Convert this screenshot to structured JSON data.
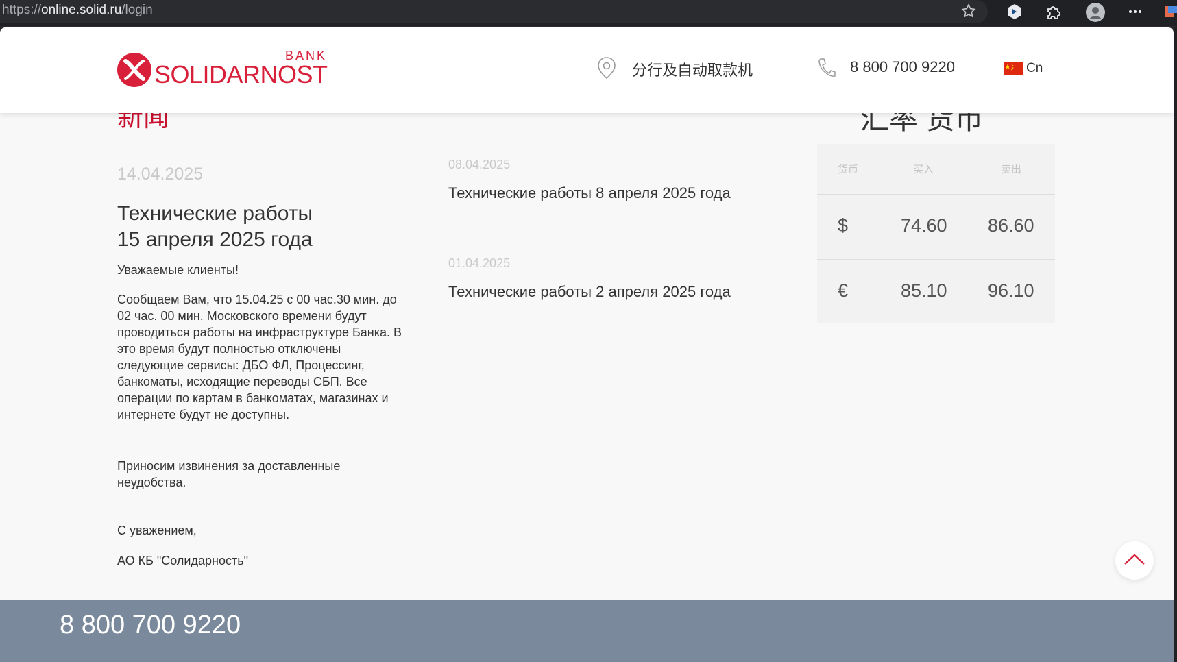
{
  "browser": {
    "url_scheme": "https://",
    "url_host": "online.solid.ru",
    "url_path": "/login"
  },
  "header": {
    "logo_bank": "BANK",
    "logo_name": "SOLIDARNOST",
    "branches_label": "分行及自动取款机",
    "phone": "8 800 700 9220",
    "language": "Cn"
  },
  "news": {
    "heading": "新闻",
    "main": {
      "date": "14.04.2025",
      "title_line1": "Технические работы",
      "title_line2": "15 апреля 2025 года",
      "greeting": "Уважаемые клиенты!",
      "paragraph": "Сообщаем Вам, что 15.04.25 с 00 час.30 мин. до 02 час. 00 мин. Московского времени будут проводиться работы на инфраструктуре Банка. В это время будут полностью отключены следующие сервисы: ДБО ФЛ, Процессинг, банкоматы, исходящие переводы СБП. Все операции по картам в банкоматах, магазинах и интернете будут не доступны.",
      "apology": "Приносим извинения за доставленные неудобства.",
      "regards": "С уважением,",
      "signature": "АО КБ \"Солидарность\""
    },
    "items": [
      {
        "date": "08.04.2025",
        "title": "Технические работы 8 апреля 2025 года"
      },
      {
        "date": "01.04.2025",
        "title": "Технические работы 2 апреля 2025 года"
      }
    ]
  },
  "rates": {
    "heading": "汇率 货币",
    "columns": [
      "货币",
      "买入",
      "卖出"
    ],
    "rows": [
      {
        "currency": "$",
        "buy": "74.60",
        "sell": "86.60"
      },
      {
        "currency": "€",
        "buy": "85.10",
        "sell": "96.10"
      }
    ]
  },
  "footer": {
    "phone": "8 800 700 9220"
  },
  "colors": {
    "brand_red": "#d8203a",
    "footer_bg": "#7a8a9c",
    "page_bg": "#f8f8f8"
  },
  "icons": [
    "star-icon",
    "extension-icon",
    "puzzle-icon",
    "profile-icon",
    "more-icon",
    "location-pin-icon",
    "phone-icon",
    "china-flag-icon",
    "chevron-up-icon"
  ]
}
